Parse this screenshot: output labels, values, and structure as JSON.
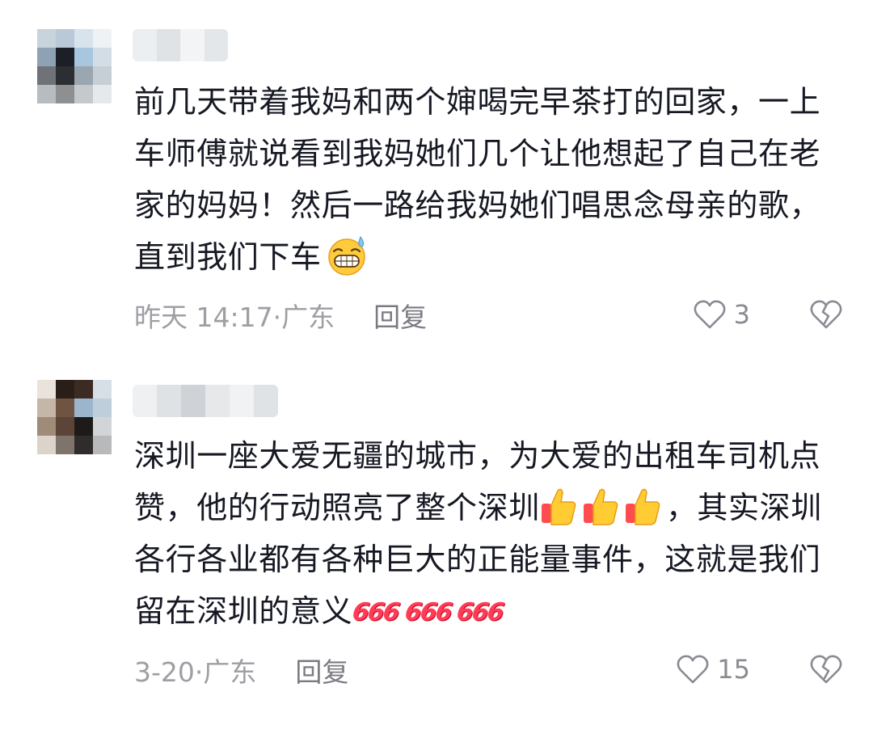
{
  "comments": [
    {
      "author": "",
      "text_parts": [
        "前几天带着我妈和两个婶喝完早茶打的回家，一上车师傅就说看到我妈她们几个让他想起了自己在老家的妈妈！然后一路给我妈她们唱思念母亲的歌，直到我们下车"
      ],
      "emoji": "grin-sweat-icon",
      "time_location": "昨天 14:17·广东",
      "reply_label": "回复",
      "like_count": "3"
    },
    {
      "author": "",
      "text_parts": [
        "深圳一座大爱无疆的城市，为大爱的出租车司机点赞，他的行动照亮了整个深圳",
        "，其实深圳各行各业都有各种巨大的正能量事件，这就是我们留在深圳的意义"
      ],
      "emoji_thumbs": [
        "thumbs-up-icon",
        "thumbs-up-icon",
        "thumbs-up-icon"
      ],
      "emoji_666": [
        "666",
        "666",
        "666"
      ],
      "time_location": "3-20·广东",
      "reply_label": "回复",
      "like_count": "15"
    }
  ],
  "colors": {
    "text": "#161823",
    "meta": "#9e9ea4",
    "reply": "#7a7a82",
    "icon": "#8a8a92",
    "accent_666": "#ff3b55"
  }
}
